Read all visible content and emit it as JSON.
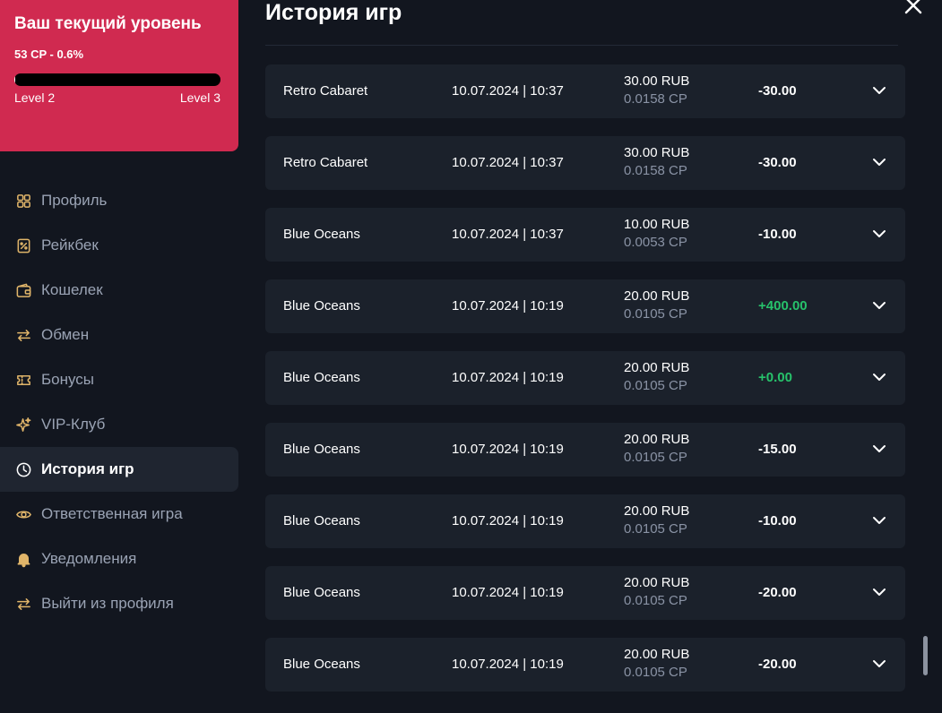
{
  "level_card": {
    "title": "Ваш текущий уровень",
    "cp_text": "53 CP - 0.6%",
    "progress_fraction": 0.006,
    "level_from": "Level 2",
    "level_to": "Level 3"
  },
  "nav": [
    {
      "label": "Профиль",
      "icon": "grid-icon"
    },
    {
      "label": "Рейкбек",
      "icon": "percent-receipt-icon"
    },
    {
      "label": "Кошелек",
      "icon": "wallet-icon"
    },
    {
      "label": "Обмен",
      "icon": "exchange-arrows-icon"
    },
    {
      "label": "Бонусы",
      "icon": "ticket-icon"
    },
    {
      "label": "VIP-Клуб",
      "icon": "sparkles-icon"
    },
    {
      "label": "История игр",
      "icon": "clock-icon",
      "active": true
    },
    {
      "label": "Ответственная игра",
      "icon": "eye-icon"
    },
    {
      "label": "Уведомления",
      "icon": "bell-icon"
    },
    {
      "label": "Выйти из профиля",
      "icon": "exit-arrows-icon"
    }
  ],
  "page": {
    "title": "История игр"
  },
  "colors": {
    "accent": "#d02a50",
    "icon_gold": "#e0b56a",
    "positive": "#27c26b",
    "row_bg": "#1b212b",
    "bg": "#12161f"
  },
  "history": [
    {
      "game": "Retro Cabaret",
      "datetime": "10.07.2024 | 10:37",
      "amount": "30.00 RUB",
      "cp": "0.0158 CP",
      "result": "-30.00",
      "positive": false
    },
    {
      "game": "Retro Cabaret",
      "datetime": "10.07.2024 | 10:37",
      "amount": "30.00 RUB",
      "cp": "0.0158 CP",
      "result": "-30.00",
      "positive": false
    },
    {
      "game": "Blue Oceans",
      "datetime": "10.07.2024 | 10:37",
      "amount": "10.00 RUB",
      "cp": "0.0053 CP",
      "result": "-10.00",
      "positive": false
    },
    {
      "game": "Blue Oceans",
      "datetime": "10.07.2024 | 10:19",
      "amount": "20.00 RUB",
      "cp": "0.0105 CP",
      "result": "+400.00",
      "positive": true
    },
    {
      "game": "Blue Oceans",
      "datetime": "10.07.2024 | 10:19",
      "amount": "20.00 RUB",
      "cp": "0.0105 CP",
      "result": "+0.00",
      "positive": true
    },
    {
      "game": "Blue Oceans",
      "datetime": "10.07.2024 | 10:19",
      "amount": "20.00 RUB",
      "cp": "0.0105 CP",
      "result": "-15.00",
      "positive": false
    },
    {
      "game": "Blue Oceans",
      "datetime": "10.07.2024 | 10:19",
      "amount": "20.00 RUB",
      "cp": "0.0105 CP",
      "result": "-10.00",
      "positive": false
    },
    {
      "game": "Blue Oceans",
      "datetime": "10.07.2024 | 10:19",
      "amount": "20.00 RUB",
      "cp": "0.0105 CP",
      "result": "-20.00",
      "positive": false
    },
    {
      "game": "Blue Oceans",
      "datetime": "10.07.2024 | 10:19",
      "amount": "20.00 RUB",
      "cp": "0.0105 CP",
      "result": "-20.00",
      "positive": false
    }
  ]
}
